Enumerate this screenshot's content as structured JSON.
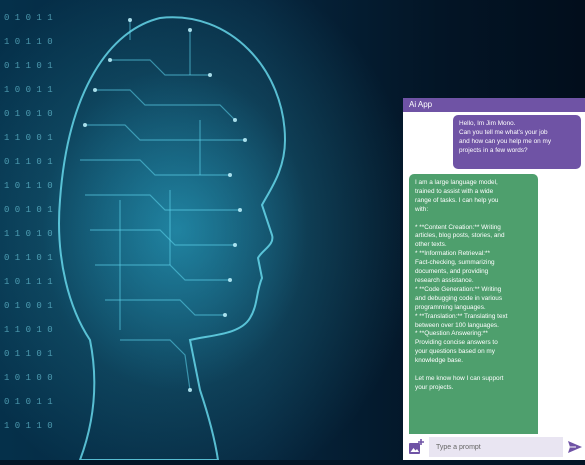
{
  "app": {
    "title": "Ai App"
  },
  "chat": {
    "user_message": "Hello, Im Jim Mono.\nCan you tell me what's your job\nand how can you help me on my\nprojects in a few words?",
    "ai_message": "I am a large language model,\ntrained to assist with a wide\nrange of tasks. I can help you\nwith:\n\n* **Content Creation:** Writing\narticles, blog posts, stories, and\nother texts.\n* **Information Retrieval:**\nFact-checking, summarizing\ndocuments, and providing\nresearch assistance.\n* **Code Generation:** Writing\nand debugging code in various\nprogramming languages.\n* **Translation:** Translating text\nbetween over 100 languages.\n* **Question Answering:**\nProviding concise answers to\nyour questions based on my\nknowledge base.\n\nLet me know how I can support\nyour projects."
  },
  "composer": {
    "placeholder": "Type a prompt"
  },
  "colors": {
    "appbar": "#6f53a5",
    "user_bubble": "#6f53a5",
    "ai_bubble": "#4e9f6d",
    "input_bg": "#e9e5f2"
  },
  "icons": {
    "attach": "add-photo-icon",
    "send": "send-icon"
  }
}
